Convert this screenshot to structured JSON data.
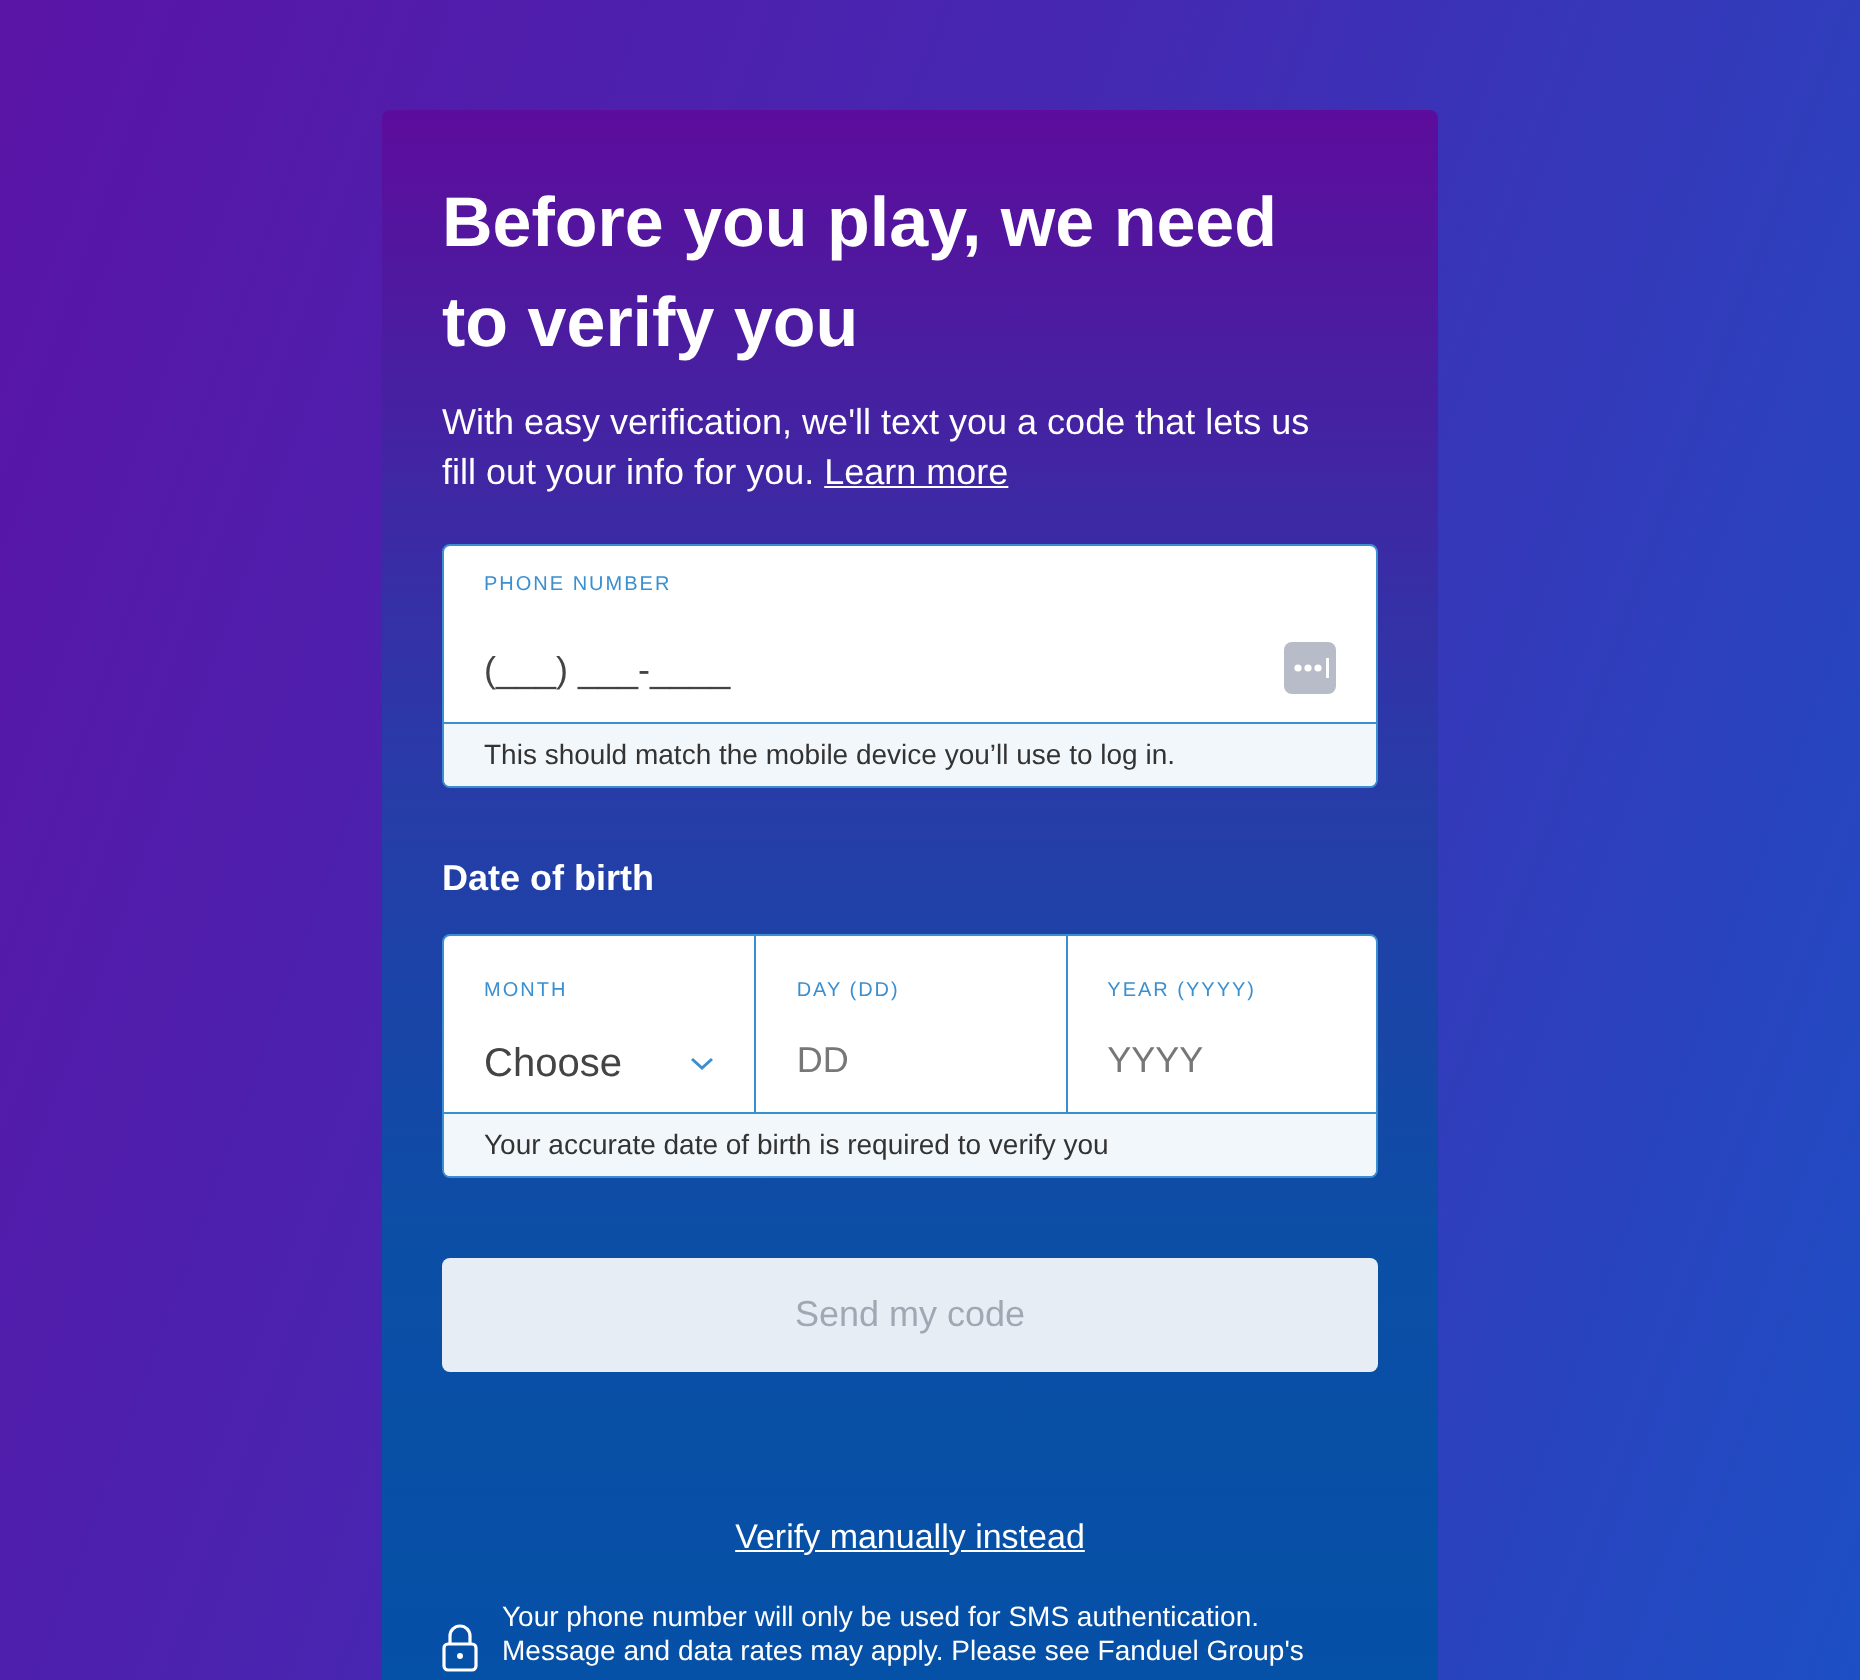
{
  "heading": "Before you play, we need to verify you",
  "intro": {
    "text": "With easy verification, we'll text you a code that lets us fill out your info for you.",
    "link": "Learn more"
  },
  "phone": {
    "label": "PHONE NUMBER",
    "placeholder": "(___) ___-____",
    "hint": "This should match the mobile device you’ll use to log in."
  },
  "dob": {
    "title": "Date of birth",
    "fields": [
      {
        "kind": "select",
        "label": "MONTH",
        "value": "Choose"
      },
      {
        "kind": "input",
        "label": "DAY (DD)",
        "placeholder": "DD"
      },
      {
        "kind": "input",
        "label": "YEAR (YYYY)",
        "placeholder": "YYYY"
      }
    ],
    "hint": "Your accurate date of birth is required to verify you"
  },
  "send_button": {
    "label": "Send my code",
    "disabled": true
  },
  "manual_link": "Verify manually instead",
  "notice": {
    "text": "Your phone number will only be used for SMS authentication. Message and data rates may apply. Please see Fanduel Group's"
  }
}
